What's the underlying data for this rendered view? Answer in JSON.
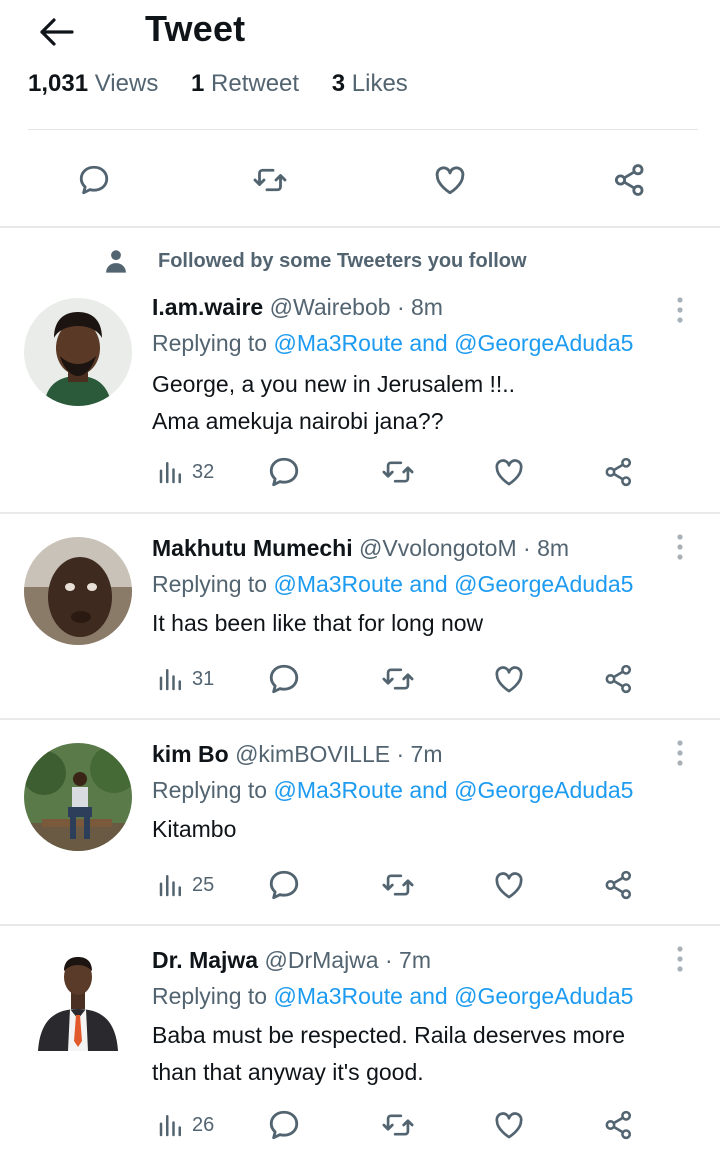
{
  "header": {
    "title": "Tweet",
    "back_icon": "arrow-left-icon"
  },
  "tweet_stats": {
    "views_value": "1,031",
    "views_label": "Views",
    "retweets_value": "1",
    "retweets_label": "Retweet",
    "likes_value": "3",
    "likes_label": "Likes"
  },
  "tweet_actions": [
    "reply-icon",
    "retweet-icon",
    "like-icon",
    "share-icon"
  ],
  "social_context": {
    "text": "Followed by some Tweeters you follow",
    "icon": "person-icon"
  },
  "replying_prefix": "Replying to",
  "replying_mention_1": "@Ma3Route",
  "replying_and": "and",
  "replying_mention_2": "@GeorgeAduda5",
  "replies": [
    {
      "name": "I.am.waire",
      "handle": "@Wairebob",
      "dot": "·",
      "time": "8m",
      "body": [
        "George, a you new in Jerusalem !!..",
        "Ama amekuja nairobi jana??"
      ],
      "views": "32"
    },
    {
      "name": "Makhutu Mumechi",
      "handle": "@VvolongotoM",
      "dot": "·",
      "time": "8m",
      "body": [
        "It has been like that for long now"
      ],
      "views": "31"
    },
    {
      "name": "kim Bo",
      "handle": "@kimBOVILLE",
      "dot": "·",
      "time": "7m",
      "body": [
        "Kitambo"
      ],
      "views": "25"
    },
    {
      "name": "Dr. Majwa",
      "handle": "@DrMajwa",
      "dot": "·",
      "time": "7m",
      "body": [
        "Baba must be respected. Raila deserves more",
        "than that anyway it's good."
      ],
      "views": "26"
    }
  ],
  "colors": {
    "accent": "#1d9bf0",
    "secondary_text": "#536471",
    "primary_text": "#0f1419",
    "divider": "#e7e9ea"
  }
}
